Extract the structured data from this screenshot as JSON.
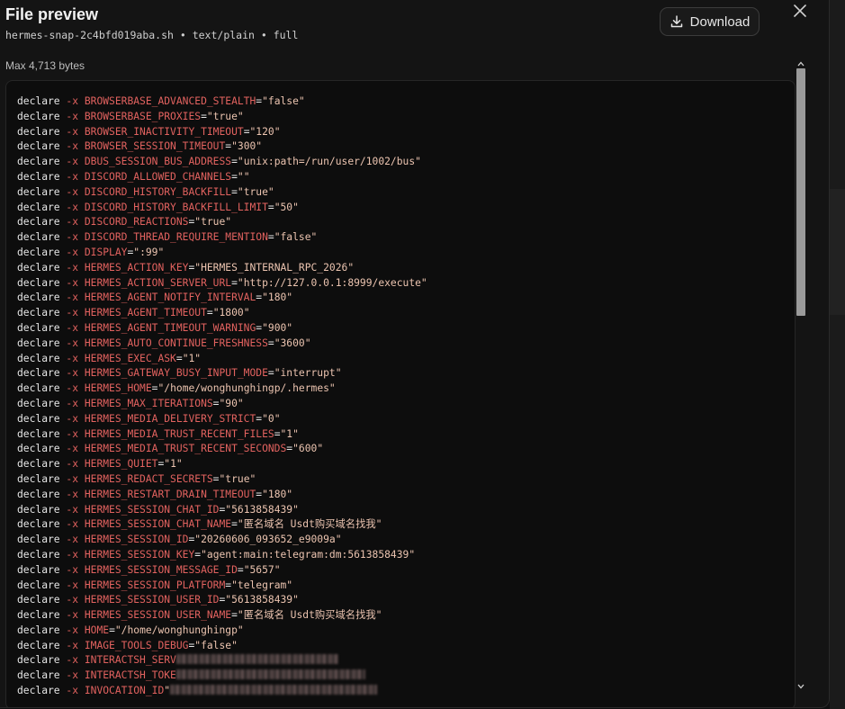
{
  "header": {
    "title": "File preview",
    "subtitle": "hermes-snap-2c4bfd019aba.sh • text/plain • full",
    "download_label": "Download",
    "close_icon": "close-icon",
    "download_icon": "download-icon"
  },
  "limit_label": "Max 4,713 bytes",
  "colors": {
    "flag": "#e2625f",
    "value": "#ecc4b0",
    "keyword": "#e6e6e6"
  },
  "code": {
    "keyword": "declare",
    "flag": "-x",
    "lines": [
      {
        "name": "BROWSERBASE_ADVANCED_STEALTH",
        "value": "\"false\""
      },
      {
        "name": "BROWSERBASE_PROXIES",
        "value": "\"true\""
      },
      {
        "name": "BROWSER_INACTIVITY_TIMEOUT",
        "value": "\"120\""
      },
      {
        "name": "BROWSER_SESSION_TIMEOUT",
        "value": "\"300\""
      },
      {
        "name": "DBUS_SESSION_BUS_ADDRESS",
        "value": "\"unix:path=/run/user/1002/bus\""
      },
      {
        "name": "DISCORD_ALLOWED_CHANNELS",
        "value": "\"\""
      },
      {
        "name": "DISCORD_HISTORY_BACKFILL",
        "value": "\"true\""
      },
      {
        "name": "DISCORD_HISTORY_BACKFILL_LIMIT",
        "value": "\"50\""
      },
      {
        "name": "DISCORD_REACTIONS",
        "value": "\"true\""
      },
      {
        "name": "DISCORD_THREAD_REQUIRE_MENTION",
        "value": "\"false\""
      },
      {
        "name": "DISPLAY",
        "value": "\":99\""
      },
      {
        "name": "HERMES_ACTION_KEY",
        "value": "\"HERMES_INTERNAL_RPC_2026\""
      },
      {
        "name": "HERMES_ACTION_SERVER_URL",
        "value": "\"http://127.0.0.1:8999/execute\""
      },
      {
        "name": "HERMES_AGENT_NOTIFY_INTERVAL",
        "value": "\"180\""
      },
      {
        "name": "HERMES_AGENT_TIMEOUT",
        "value": "\"1800\""
      },
      {
        "name": "HERMES_AGENT_TIMEOUT_WARNING",
        "value": "\"900\""
      },
      {
        "name": "HERMES_AUTO_CONTINUE_FRESHNESS",
        "value": "\"3600\""
      },
      {
        "name": "HERMES_EXEC_ASK",
        "value": "\"1\""
      },
      {
        "name": "HERMES_GATEWAY_BUSY_INPUT_MODE",
        "value": "\"interrupt\""
      },
      {
        "name": "HERMES_HOME",
        "value": "\"/home/wonghunghingp/.hermes\""
      },
      {
        "name": "HERMES_MAX_ITERATIONS",
        "value": "\"90\""
      },
      {
        "name": "HERMES_MEDIA_DELIVERY_STRICT",
        "value": "\"0\""
      },
      {
        "name": "HERMES_MEDIA_TRUST_RECENT_FILES",
        "value": "\"1\""
      },
      {
        "name": "HERMES_MEDIA_TRUST_RECENT_SECONDS",
        "value": "\"600\""
      },
      {
        "name": "HERMES_QUIET",
        "value": "\"1\""
      },
      {
        "name": "HERMES_REDACT_SECRETS",
        "value": "\"true\""
      },
      {
        "name": "HERMES_RESTART_DRAIN_TIMEOUT",
        "value": "\"180\""
      },
      {
        "name": "HERMES_SESSION_CHAT_ID",
        "value": "\"5613858439\""
      },
      {
        "name": "HERMES_SESSION_CHAT_NAME",
        "value": "\"匿名域名 Usdt购买域名找我\""
      },
      {
        "name": "HERMES_SESSION_ID",
        "value": "\"20260606_093652_e9009a\""
      },
      {
        "name": "HERMES_SESSION_KEY",
        "value": "\"agent:main:telegram:dm:5613858439\""
      },
      {
        "name": "HERMES_SESSION_MESSAGE_ID",
        "value": "\"5657\""
      },
      {
        "name": "HERMES_SESSION_PLATFORM",
        "value": "\"telegram\""
      },
      {
        "name": "HERMES_SESSION_USER_ID",
        "value": "\"5613858439\""
      },
      {
        "name": "HERMES_SESSION_USER_NAME",
        "value": "\"匿名域名 Usdt购买域名找我\""
      },
      {
        "name": "HOME",
        "value": "\"/home/wonghunghingp\""
      },
      {
        "name": "IMAGE_TOOLS_DEBUG",
        "value": "\"false\""
      },
      {
        "name": "INTERACTSH_SERV",
        "value": "",
        "redacted": true
      },
      {
        "name": "INTERACTSH_TOKE",
        "value": "",
        "redacted": true
      },
      {
        "name": "INVOCATION_ID",
        "value": "\"",
        "redacted": true
      }
    ]
  }
}
